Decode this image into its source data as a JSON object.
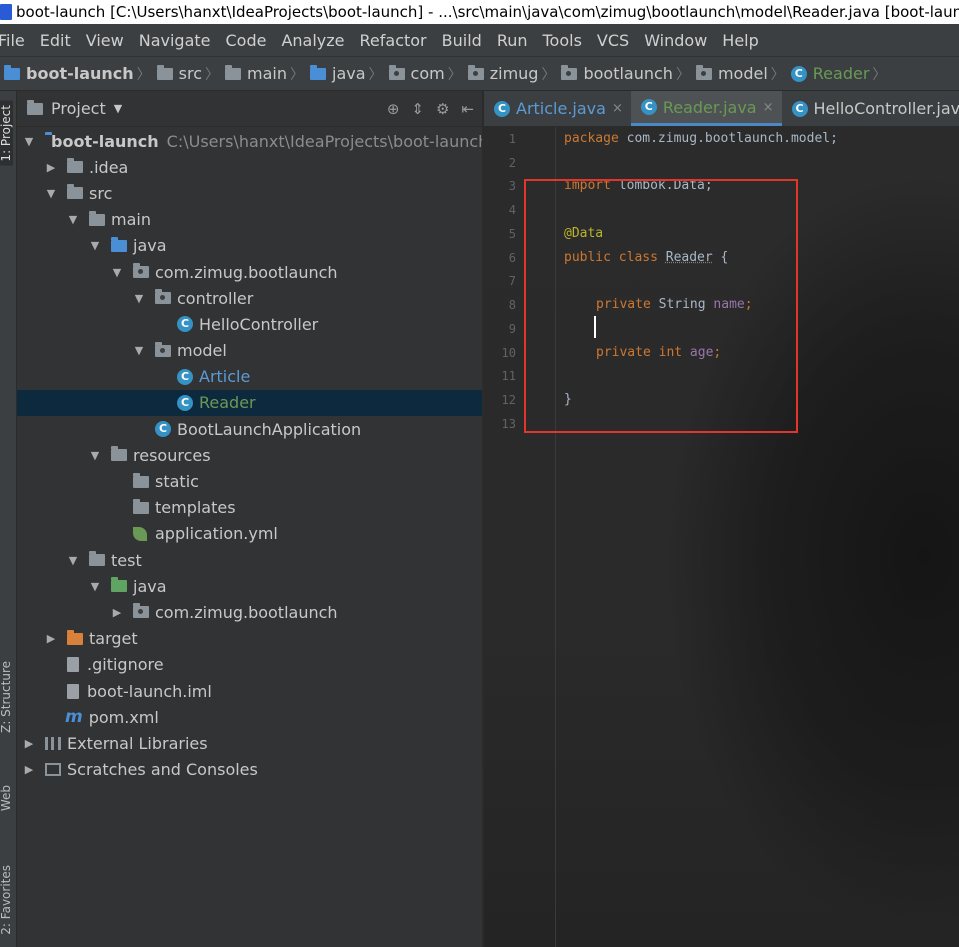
{
  "window": {
    "title": "boot-launch [C:\\Users\\hanxt\\IdeaProjects\\boot-launch] - ...\\src\\main\\java\\com\\zimug\\bootlaunch\\model\\Reader.java [boot-launch]"
  },
  "menu": [
    "File",
    "Edit",
    "View",
    "Navigate",
    "Code",
    "Analyze",
    "Refactor",
    "Build",
    "Run",
    "Tools",
    "VCS",
    "Window",
    "Help"
  ],
  "breadcrumb": [
    "boot-launch",
    "src",
    "main",
    "java",
    "com",
    "zimug",
    "bootlaunch",
    "model",
    "Reader"
  ],
  "side_tabs": {
    "project": "1: Project",
    "structure": "Z: Structure",
    "web": "Web",
    "favorites": "2: Favorites"
  },
  "project_panel": {
    "title": "Project",
    "root_path": "C:\\Users\\hanxt\\IdeaProjects\\boot-launch"
  },
  "tree": [
    "boot-launch",
    ".idea",
    "src",
    "main",
    "java",
    "com.zimug.bootlaunch",
    "controller",
    "HelloController",
    "model",
    "Article",
    "Reader",
    "BootLaunchApplication",
    "resources",
    "static",
    "templates",
    "application.yml",
    "test",
    "java",
    "com.zimug.bootlaunch",
    "target",
    ".gitignore",
    "boot-launch.iml",
    "pom.xml",
    "External Libraries",
    "Scratches and Consoles"
  ],
  "tabs": [
    {
      "label": "Article.java",
      "close": "×"
    },
    {
      "label": "Reader.java",
      "close": "×"
    },
    {
      "label": "HelloController.java"
    }
  ],
  "code": {
    "line_numbers": [
      "1",
      "2",
      "3",
      "4",
      "5",
      "6",
      "7",
      "8",
      "9",
      "10",
      "11",
      "12",
      "13"
    ],
    "l1_kw": "package",
    "l1_rest": " com.zimug.bootlaunch.model;",
    "l3_kw": "import",
    "l3_rest": " lombok.Data;",
    "l5_ann": "@Data",
    "l6_kw": "public class",
    "l6_cls": "Reader",
    "l6_rest": " {",
    "l8_kw": "private",
    "l8_type": " String ",
    "l8_field": "name",
    "l8_end": ";",
    "l10_kw": "private int",
    "l10_field": "age",
    "l10_end": ";",
    "l12": "}"
  },
  "colors": {
    "highlight_box": "#e0362c",
    "keyword": "#cc7832",
    "annotation": "#bbb529",
    "field": "#9876aa",
    "selected_row": "#0d293e"
  }
}
